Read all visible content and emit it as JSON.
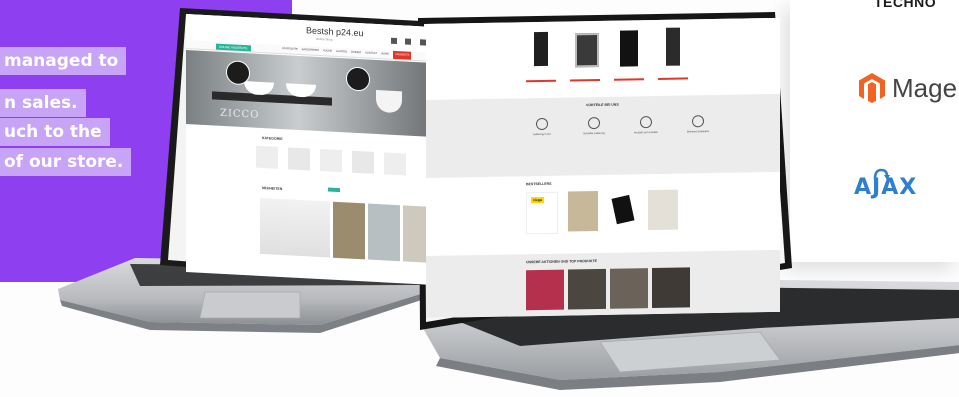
{
  "quote": {
    "lines": [
      "managed to",
      "n sales.",
      "uch to the",
      "of our store."
    ]
  },
  "tech": {
    "title": "TECHNO",
    "items": [
      {
        "label": "Mage",
        "icon": "magento-icon"
      },
      {
        "label": "AJAX",
        "icon": "ajax-icon"
      }
    ]
  },
  "laptop_left": {
    "site_logo": "Bestsh  p24.eu",
    "site_tagline": "Online Shop",
    "menu": [
      "STARTSEITE",
      "BADEZIMMER",
      "KUCHE",
      "GARTEN",
      "ZIMMER",
      "KONTAKT",
      "HOME",
      "ANGEBOTE"
    ],
    "promo_tag": "ONLINE ANGEBOTE",
    "hero_brand": "ZICCO",
    "categories_title": "KATEGORIE",
    "highlights_title": "NEUHEITEN"
  },
  "laptop_right": {
    "advantages_title": "VORTEILE BEI UNS",
    "advantages": [
      "Lieferung in EU",
      "Schnelle Lieferung",
      "Kontakt zum Kunden",
      "Sicheres Einkaufen"
    ],
    "bestsellers_title": "BESTSELLERS",
    "brand_badge": "viega",
    "recommend_title": "UNSERE AKTIONEN UND TOP PRODUKTE"
  },
  "colors": {
    "purple": "#8e3ff0",
    "quote_band": "#c7a4f5",
    "accent_green": "#27b59a",
    "accent_red": "#e3362b",
    "magento_orange": "#f26322",
    "ajax_blue": "#2d7fd0"
  }
}
